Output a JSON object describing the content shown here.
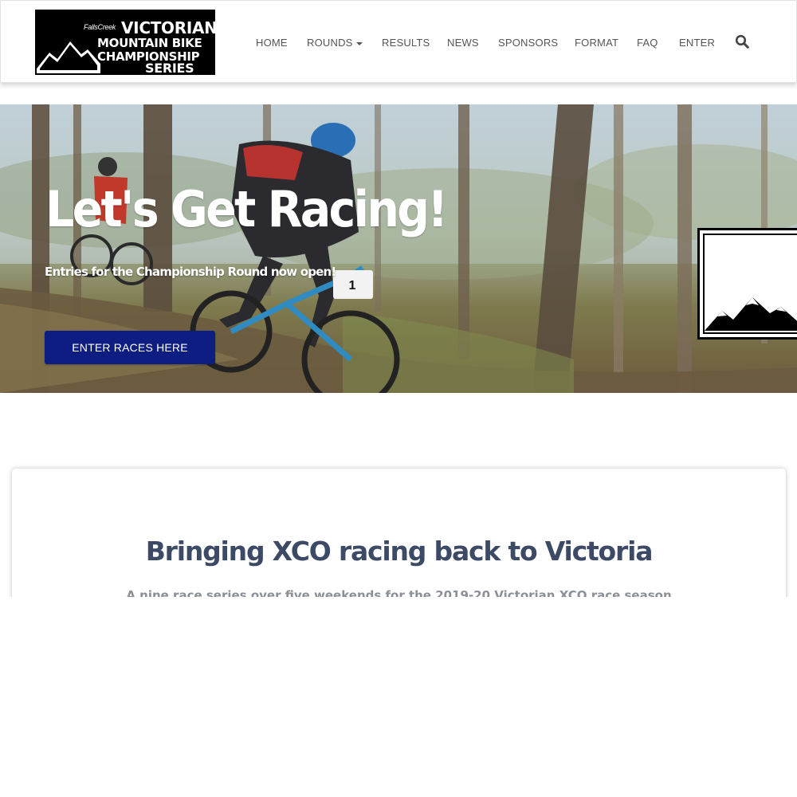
{
  "logo": {
    "small": "FallsCreek",
    "line1": "VICTORIAN",
    "line2": "MOUNTAIN BIKE",
    "line3": "CHAMPIONSHIP",
    "line4": "SERIES"
  },
  "nav": {
    "items": [
      {
        "label": "HOME"
      },
      {
        "label": "ROUNDS",
        "has_dropdown": true
      },
      {
        "label": "RESULTS"
      },
      {
        "label": "NEWS"
      },
      {
        "label": "SPONSORS"
      },
      {
        "label": "FORMAT"
      },
      {
        "label": "FAQ"
      },
      {
        "label": "ENTER"
      }
    ],
    "search_icon": "search-icon"
  },
  "hero": {
    "title": "Let's Get Racing!",
    "subtitle": "Entries for the Championship Round now open!",
    "button_label": "ENTER RACES HERE",
    "bib_number": "1"
  },
  "intro": {
    "heading": "Bringing XCO racing back to Victoria",
    "lead": "A nine race series over five weekends for the 2019-20 Victorian XCO race season"
  },
  "colors": {
    "button": "#0d1d82",
    "heading": "#3c4a66",
    "nav_text": "#555555"
  }
}
